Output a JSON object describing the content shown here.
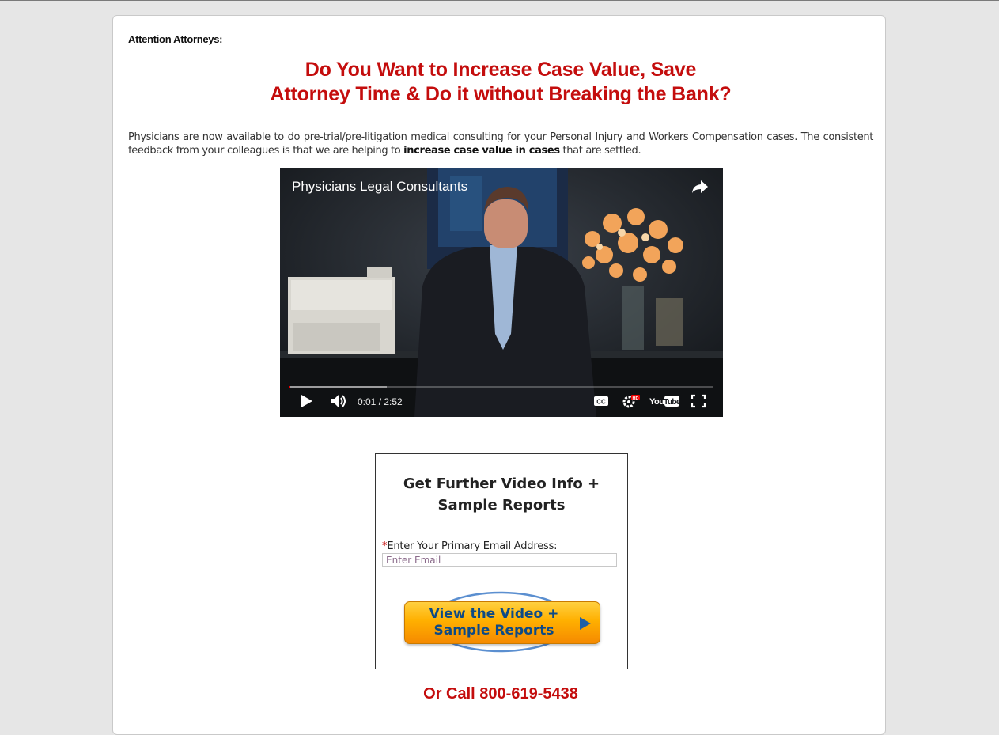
{
  "header": {
    "attention": "Attention Attorneys:",
    "headline_line1": "Do You Want to Increase Case Value, Save",
    "headline_line2": "Attorney Time & Do it without Breaking the Bank?"
  },
  "intro": {
    "text_before": "Physicians are now available to do pre-trial/pre-litigation medical consulting for your Personal Injury and Workers Compensation cases. The consistent feedback from your colleagues is that we are helping to ",
    "text_bold": "increase case value in cases",
    "text_after": " that are settled."
  },
  "video": {
    "title": "Physicians Legal Consultants",
    "time": "0:01 / 2:52",
    "played_fraction": 0.002,
    "buffered_fraction": 0.23,
    "icons": [
      "share-icon",
      "play-icon",
      "volume-icon",
      "cc-icon",
      "settings-hd-icon",
      "youtube-logo",
      "fullscreen-icon"
    ]
  },
  "form": {
    "title_line1": "Get Further Video Info +",
    "title_line2": "Sample Reports",
    "email_required_mark": "*",
    "email_label": "Enter Your Primary Email Address:",
    "email_placeholder": "Enter Email",
    "email_value": "",
    "cta_line1": "View the Video +",
    "cta_line2": "Sample Reports"
  },
  "phone": {
    "text": "Or Call 800-619-5438"
  },
  "colors": {
    "accent_red": "#c40d0d",
    "cta_orange": "#ffb000",
    "cta_text_blue": "#0d4a86",
    "background": "#e6e6e6"
  }
}
